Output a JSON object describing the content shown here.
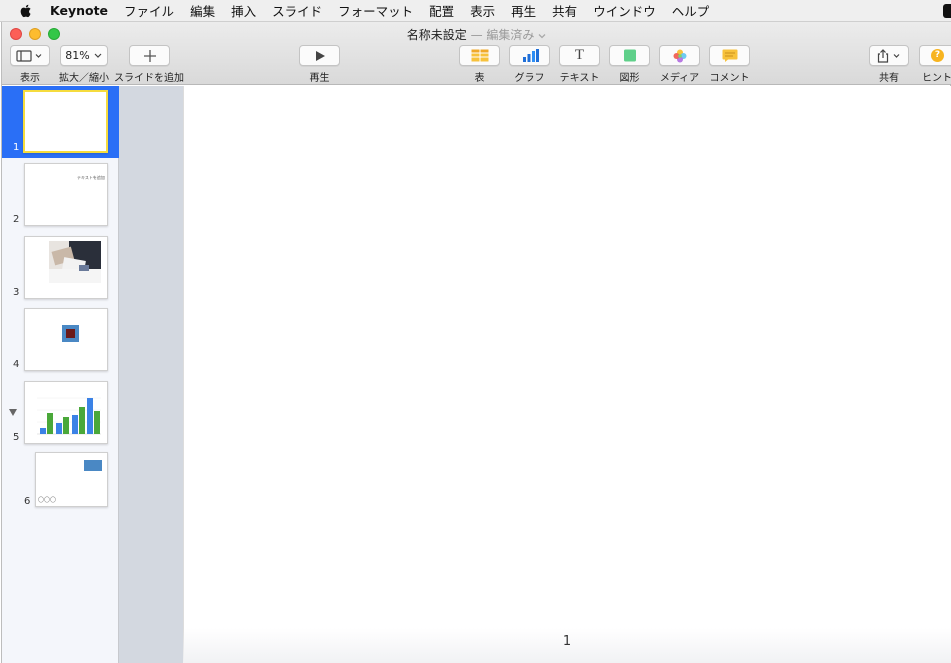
{
  "menubar": {
    "app_name": "Keynote",
    "items": [
      "ファイル",
      "編集",
      "挿入",
      "スライド",
      "フォーマット",
      "配置",
      "表示",
      "再生",
      "共有",
      "ウインドウ",
      "ヘルプ"
    ]
  },
  "window": {
    "title": "名称未設定",
    "status": "— 編集済み"
  },
  "toolbar": {
    "view_label": "表示",
    "zoom_value": "81%",
    "zoom_label": "拡大／縮小",
    "add_slide_label": "スライドを追加",
    "play_label": "再生",
    "table_label": "表",
    "chart_label": "グラフ",
    "text_label": "テキスト",
    "text_glyph": "T",
    "shape_label": "図形",
    "media_label": "メディア",
    "comment_label": "コメント",
    "share_label": "共有",
    "hint_label": "ヒント",
    "hint_glyph": "?"
  },
  "navigator": {
    "slides": [
      {
        "number": "1",
        "selected": true
      },
      {
        "number": "2",
        "text": "テキストを追加"
      },
      {
        "number": "3"
      },
      {
        "number": "4"
      },
      {
        "number": "5",
        "collapsible": true
      },
      {
        "number": "6",
        "text": "〇〇〇"
      }
    ]
  },
  "canvas": {
    "page_number": "1"
  },
  "colors": {
    "selection": "#2a6ff6",
    "selected_border": "#f6dc3d",
    "chart_blue": "#3b82e6",
    "chart_green": "#4aa83a"
  }
}
